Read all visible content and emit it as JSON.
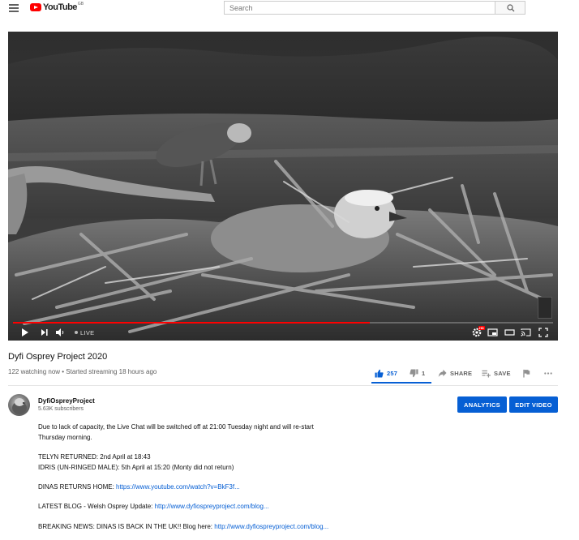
{
  "masthead": {
    "logo_text": "YouTube",
    "country_code": "GB",
    "search_placeholder": "Search"
  },
  "player": {
    "live_label": "LIVE",
    "progress_fraction": 0.66,
    "hd_badge": "HD"
  },
  "video": {
    "title": "Dyfi Osprey Project 2020",
    "meta": "122 watching now • Started streaming 18 hours ago",
    "like_count": "257",
    "dislike_count": "1",
    "share_label": "SHARE",
    "save_label": "SAVE",
    "like_ratio": 0.996
  },
  "owner": {
    "channel_name": "DyfiOspreyProject",
    "subscribers": "5.63K subscribers",
    "analytics_label": "ANALYTICS",
    "edit_label": "EDIT VIDEO"
  },
  "description": {
    "line1": "Due to lack of capacity, the Live Chat will be switched off at 21:00 Tuesday night and will re-start",
    "line2": "Thursday morning.",
    "line3": "TELYN RETURNED: 2nd April at 18:43",
    "line4": "IDRIS (UN-RINGED MALE): 5th April at 15:20 (Monty did not return)",
    "line5_text": "DINAS RETURNS HOME: ",
    "line5_link": "https://www.youtube.com/watch?v=BkF3f...",
    "line6_text": "LATEST BLOG - Welsh Osprey Update: ",
    "line6_link": "http://www.dyfiospreyproject.com/blog...",
    "line7_text": "BREAKING NEWS: DINAS IS BACK IN THE UK!! Blog here: ",
    "line7_link": "http://www.dyfiospreyproject.com/blog..."
  },
  "colors": {
    "accent_blue": "#065fd4",
    "youtube_red": "#ff0000",
    "text_secondary": "#606060"
  }
}
